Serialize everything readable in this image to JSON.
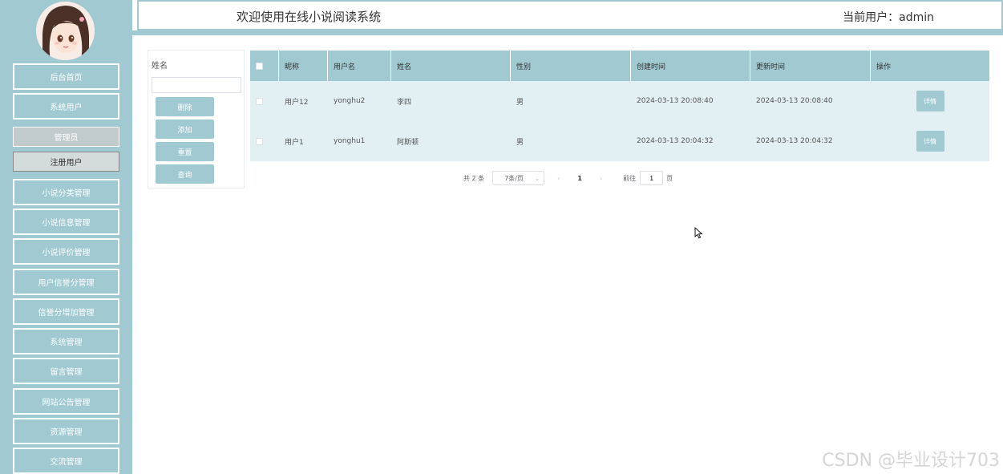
{
  "header": {
    "title": "欢迎使用在线小说阅读系统",
    "user": "当前用户：admin"
  },
  "sidebar": {
    "items": [
      "后台首页",
      "系统用户"
    ],
    "sub_items": [
      "管理员",
      "注册用户"
    ],
    "items2": [
      "小说分类管理",
      "小说信息管理",
      "小说评价管理",
      "用户信誉分管理",
      "信誉分增加管理",
      "系统管理",
      "留言管理",
      "网站公告管理",
      "资源管理",
      "交流管理"
    ]
  },
  "search": {
    "label": "姓名",
    "value": "",
    "buttons": [
      "删除",
      "添加",
      "重置",
      "查询"
    ]
  },
  "table": {
    "columns": [
      "昵称",
      "用户名",
      "姓名",
      "性别",
      "创建时间",
      "更新时间",
      "操作"
    ],
    "rows": [
      {
        "nickname": "用户12",
        "username": "yonghu2",
        "name": "李四",
        "gender": "男",
        "created": "2024-03-13 20:08:40",
        "updated": "2024-03-13 20:08:40",
        "action": "详情"
      },
      {
        "nickname": "用户1",
        "username": "yonghu1",
        "name": "阿斯顿",
        "gender": "男",
        "created": "2024-03-13 20:04:32",
        "updated": "2024-03-13 20:04:32",
        "action": "详情"
      }
    ]
  },
  "pagination": {
    "total": "共 2 条",
    "page_size": "7条/页",
    "prev": "‹",
    "current": "1",
    "next": "›",
    "goto_label": "前往",
    "goto_value": "1",
    "unit": "页"
  },
  "watermark": "CSDN @毕业设计703",
  "colors": {
    "accent": "#a0c9d2",
    "row_bg": "#e3f0f3"
  }
}
